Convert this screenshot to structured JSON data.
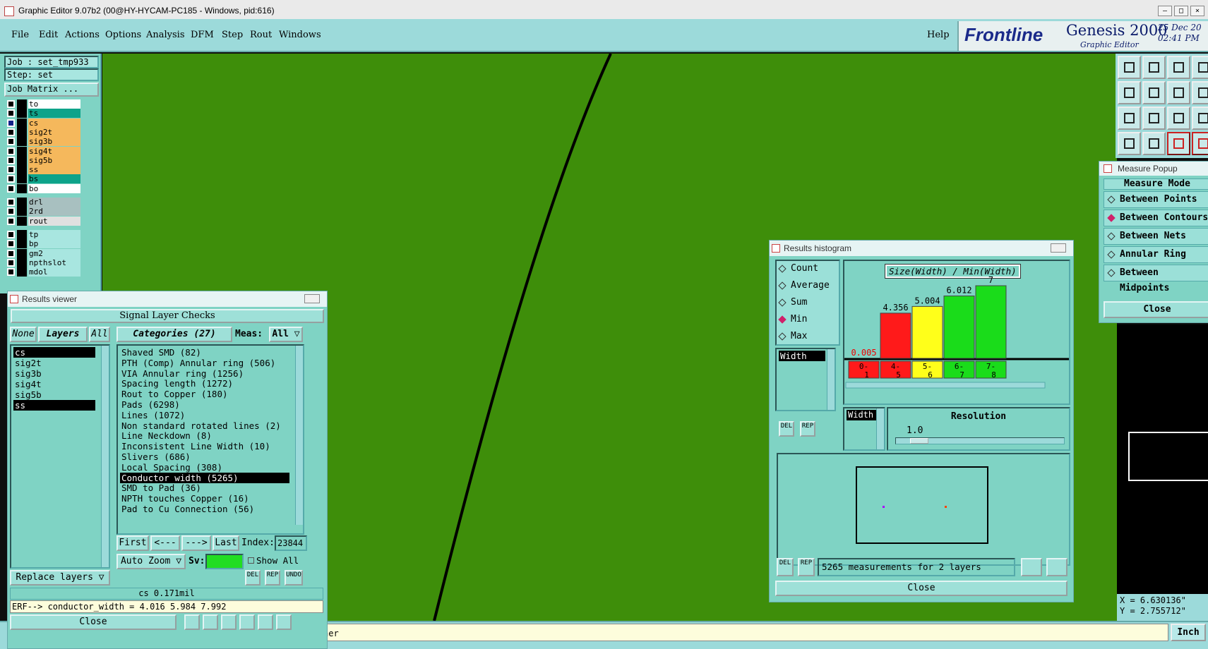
{
  "window": {
    "title": "Graphic Editor 9.07b2 (00@HY-HYCAM-PC185 - Windows, pid:616)",
    "controls": [
      "–",
      "□",
      "×"
    ]
  },
  "menu": {
    "items": [
      "File",
      "Edit",
      "Actions",
      "Options",
      "Analysis",
      "DFM",
      "Step",
      "Rout",
      "Windows"
    ],
    "help": "Help"
  },
  "brand": {
    "name": "Frontline",
    "product": "Genesis 2000",
    "subtitle": "Graphic Editor",
    "date": "25 Dec 20",
    "time": "02:41 PM"
  },
  "left_panel": {
    "job": "Job : set_tmp933",
    "step": "Step: set",
    "job_matrix": "Job Matrix ...",
    "layers": [
      {
        "name": "to",
        "color": "#ffffff"
      },
      {
        "name": "ts",
        "color": "#0ea38a"
      },
      {
        "name": "cs",
        "color": "#f5b85c",
        "active": true
      },
      {
        "name": "sig2t",
        "color": "#f5b85c"
      },
      {
        "name": "sig3b",
        "color": "#f5b85c"
      },
      {
        "name": "sig4t",
        "color": "#f5b85c"
      },
      {
        "name": "sig5b",
        "color": "#f5b85c"
      },
      {
        "name": "ss",
        "color": "#f5b85c"
      },
      {
        "name": "bs",
        "color": "#0ea38a"
      },
      {
        "name": "bo",
        "color": "#ffffff"
      },
      {
        "name": "drl",
        "color": "#a8c0c0"
      },
      {
        "name": "2rd",
        "color": "#a8c0c0"
      },
      {
        "name": "rout",
        "color": "#e0e0e0"
      },
      {
        "name": "tp",
        "color": "#a8e6e0"
      },
      {
        "name": "bp",
        "color": "#a8e6e0"
      },
      {
        "name": "gm2",
        "color": "#a8e6e0"
      },
      {
        "name": "npthslot",
        "color": "#a8e6e0"
      },
      {
        "name": "mdol",
        "color": "#a8e6e0"
      }
    ]
  },
  "results_viewer": {
    "title": "Results viewer",
    "header": "Signal Layer Checks",
    "none_btn": "None",
    "layers_label": "Layers",
    "all_btn": "All",
    "categories_label": "Categories (27)",
    "meas_label": "Meas:",
    "meas_value": "All",
    "layers": [
      "cs",
      "sig2t",
      "sig3b",
      "sig4t",
      "sig5b",
      "ss"
    ],
    "categories": [
      "Shaved SMD (82)",
      "PTH (Comp) Annular ring (506)",
      "VIA Annular ring (1256)",
      "Spacing length (1272)",
      "Rout to Copper (180)",
      "Pads (6298)",
      "Lines (1072)",
      "Non standard rotated lines (2)",
      "Line Neckdown (8)",
      "Inconsistent Line Width (10)",
      "Slivers (686)",
      "Local Spacing (308)",
      "Conductor width (5265)",
      "SMD to Pad (36)",
      "NPTH touches Copper (16)",
      "Pad to Cu Connection (56)"
    ],
    "selected_category": "Conductor width (5265)",
    "nav": {
      "first": "First",
      "prev": "<---",
      "next": "--->",
      "last": "Last",
      "index_label": "Index:",
      "index_value": "23844"
    },
    "auto_zoom": "Auto Zoom",
    "sv_label": "Sv:",
    "show_all": "Show All",
    "replace_layers": "Replace layers",
    "del": "DEL",
    "rep": "REP",
    "undo": "UNDO",
    "status": "cs 0.171mil",
    "erf": "ERF--> conductor_width = 4.016 5.984 7.992",
    "close": "Close"
  },
  "results_histogram": {
    "title": "Results histogram",
    "options": [
      "Count",
      "Average",
      "Sum",
      "Min",
      "Max"
    ],
    "selected_option": "Min",
    "measure_item": "Width",
    "del": "DEL",
    "rep": "REP",
    "chart_title": "Size(Width) / Min(Width)",
    "width_label": "Width",
    "resolution_label": "Resolution",
    "resolution_value": "1.0",
    "status": "5265 measurements for 2 layers",
    "close": "Close"
  },
  "chart_data": {
    "type": "bar",
    "title": "Size(Width) / Min(Width)",
    "categories": [
      "0-1",
      "4-5",
      "5-6",
      "6-7",
      "7-8"
    ],
    "values": [
      0.005,
      4.356,
      5.004,
      6.012,
      7
    ],
    "value_labels": [
      "0.005",
      "4.356",
      "5.004",
      "6.012",
      "7"
    ],
    "colors": [
      "#ff1a1a",
      "#ff1a1a",
      "#ffff1a",
      "#1adc1a",
      "#1adc1a"
    ],
    "ylim": [
      0,
      7
    ]
  },
  "measure_popup": {
    "title": "Measure Popup",
    "mode_label": "Measure Mode",
    "options": [
      "Between Points",
      "Between Contours",
      "Between Nets",
      "Annular Ring",
      "Between Midpoints"
    ],
    "selected": "Between Contours",
    "close": "Close"
  },
  "readout": {
    "x": "X = 6.630136\"",
    "y": "Y = 2.755712\""
  },
  "statusbar": {
    "input_text": "ner",
    "units": "Inch"
  }
}
